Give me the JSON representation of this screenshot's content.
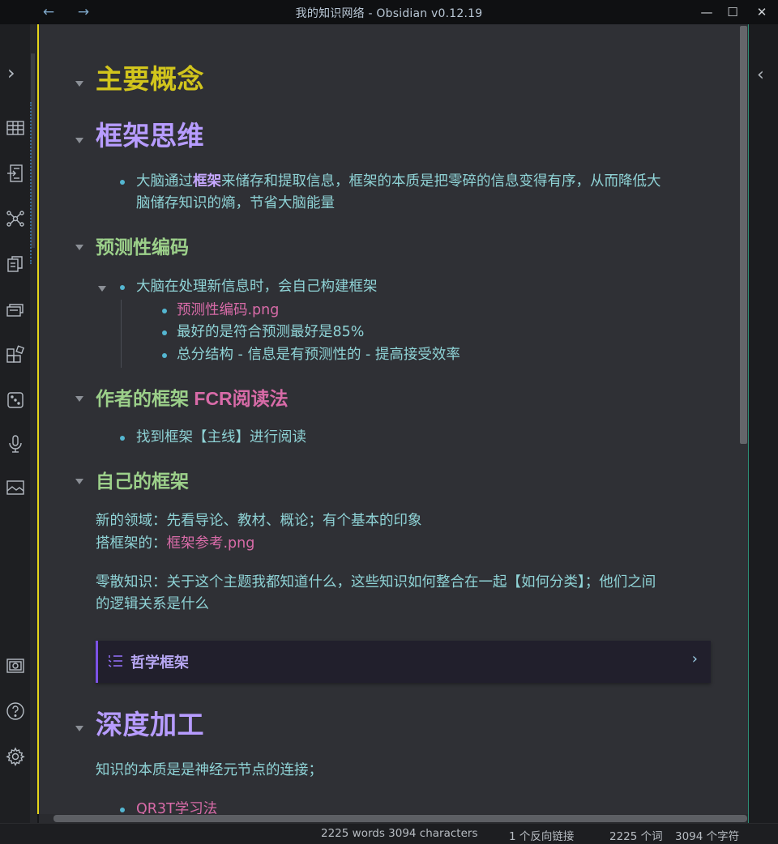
{
  "window": {
    "title": "我的知识网络 - Obsidian v0.12.19",
    "back_glyph": "←",
    "forward_glyph": "→",
    "minimize_glyph": "—",
    "maximize_glyph": "☐",
    "close_glyph": "✕"
  },
  "ribbon": {
    "expand_glyph": "›",
    "icons": [
      "table-icon",
      "import-icon",
      "graph-icon",
      "copy-notes-icon",
      "cards-icon",
      "blocks-icon",
      "dice-icon",
      "microphone-icon",
      "image-icon",
      "vault-icon",
      "help-icon",
      "settings-icon"
    ]
  },
  "right_panel": {
    "expand_glyph": "‹"
  },
  "note": {
    "h1_main": "主要概念",
    "h1_framework": "框架思维",
    "framework_bullet_line1_pre": "大脑通过",
    "framework_bullet_bold": "框架",
    "framework_bullet_line1_post": "来储存和提取信息，框架的本质是把零碎的信息变得有序，从而降低大",
    "framework_bullet_line2": "脑储存知识的熵，节省大脑能量",
    "h2_predictive": "预测性编码",
    "predictive_bullet": "大脑在处理新信息时，会自己构建框架",
    "predictive_sub_link": "预测性编码.png",
    "predictive_sub_2": "最好的是符合预测最好是85%",
    "predictive_sub_3": "总分结构 - 信息是有预测性的 - 提高接受效率",
    "h2_author_pre": "作者的框架 ",
    "h2_author_link": "FCR阅读法",
    "author_bullet": "找到框架【主线】进行阅读",
    "h2_own": "自己的框架",
    "own_line1": "新的领域：先看导论、教材、概论；有个基本的印象",
    "own_line2_pre": "搭框架的：",
    "own_line2_link": "框架参考.png",
    "own_para_line1": "零散知识：关于这个主题我都知道什么，这些知识如何整合在一起【如何分类】；他们之间",
    "own_para_line2": "的逻辑关系是什么",
    "callout_title": "哲学框架",
    "callout_chevron": "›",
    "h1_deep": "深度加工",
    "deep_line": "知识的本质是是神经元节点的连接；",
    "deep_bullet_link": "QR3T学习法"
  },
  "status": {
    "words_chars_en": "2225 words 3094 characters",
    "backlinks": "1 个反向链接",
    "words_zh": "2225 个词",
    "chars_zh": "3094 个字符"
  },
  "colors": {
    "h1_main": "#d2c51c",
    "h1_purple": "#b79cff",
    "h2_green": "#9cd08a",
    "text_cyan": "#8fd3d6",
    "link_pink": "#d86ba8",
    "accent_purple": "#7c52e6"
  }
}
